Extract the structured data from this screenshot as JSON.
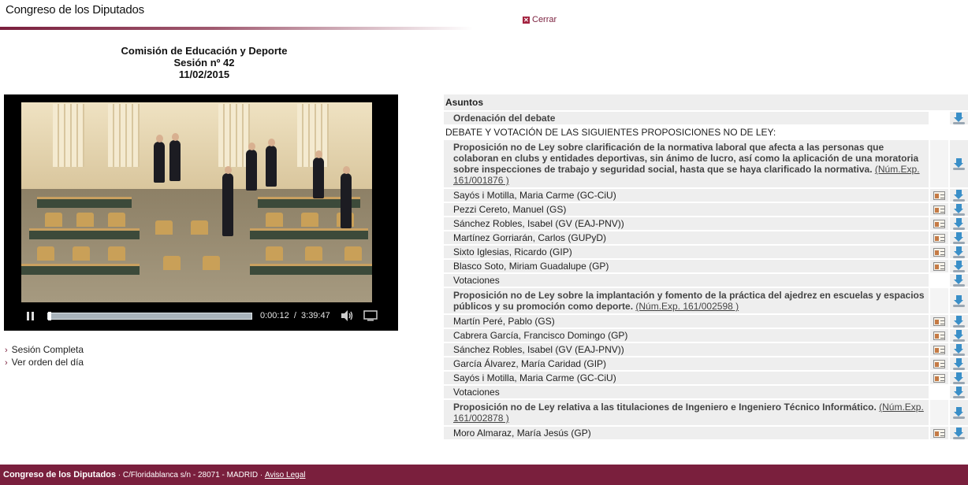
{
  "header": {
    "site_title": "Congreso de los Diputados",
    "close_label": "Cerrar"
  },
  "session": {
    "commission": "Comisión de Educación y Deporte",
    "number": "Sesión nº 42",
    "date": "11/02/2015"
  },
  "player": {
    "current_time": "0:00:12",
    "separator": "/",
    "duration": "3:39:47",
    "progress_fraction": 0.008
  },
  "links": {
    "full_session": "Sesión Completa",
    "agenda": "Ver orden del día"
  },
  "agenda": {
    "header": "Asuntos",
    "ordering": "Ordenación del debate",
    "debate_heading": "DEBATE Y VOTACIÓN DE LAS SIGUIENTES PROPOSICIONES NO DE LEY:",
    "items": [
      {
        "title": "Proposición no de Ley sobre clarificación de la normativa laboral que afecta a las personas que colaboran en clubs y entidades deportivas, sin ánimo de lucro, así como la aplicación de una moratoria sobre inspecciones de trabajo y seguridad social, hasta que se haya clarificado la normativa.",
        "exp": "(Núm.Exp. 161/001876 )",
        "speakers": [
          "Sayós i Motilla, Maria Carme (GC-CiU)",
          "Pezzi Cereto, Manuel (GS)",
          "Sánchez Robles, Isabel (GV (EAJ-PNV))",
          "Martínez Gorriarán, Carlos (GUPyD)",
          "Sixto Iglesias, Ricardo (GIP)",
          "Blasco Soto, Miriam Guadalupe (GP)"
        ],
        "votes": "Votaciones"
      },
      {
        "title": "Proposición no de Ley sobre la implantación y fomento de la práctica del ajedrez en escuelas y espacios públicos y su promoción como deporte.",
        "exp": "(Núm.Exp. 161/002598 )",
        "speakers": [
          "Martín Peré, Pablo (GS)",
          "Cabrera García, Francisco Domingo (GP)",
          "Sánchez Robles, Isabel (GV (EAJ-PNV))",
          "García Álvarez, María Caridad (GIP)",
          "Sayós i Motilla, Maria Carme (GC-CiU)"
        ],
        "votes": "Votaciones"
      },
      {
        "title": "Proposición no de Ley relativa a las titulaciones de Ingeniero e Ingeniero Técnico Informático.",
        "exp": "(Núm.Exp. 161/002878 )",
        "speakers": [
          "Moro Almaraz, María Jesús (GP)"
        ]
      }
    ]
  },
  "footer": {
    "name": "Congreso de los Diputados",
    "address": " · C/Floridablanca s/n - 28071 - MADRID · ",
    "legal": "Aviso Legal"
  }
}
